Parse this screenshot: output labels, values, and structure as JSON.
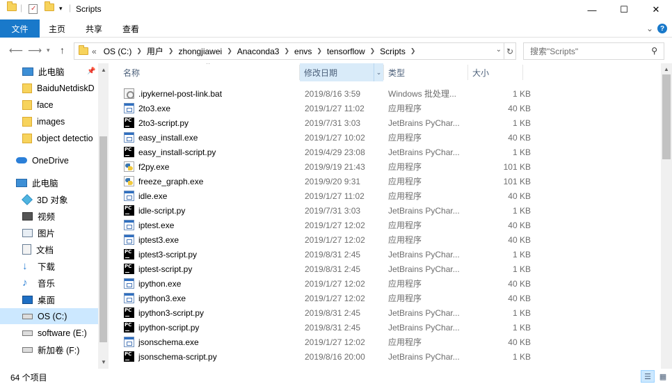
{
  "window": {
    "title": "Scripts",
    "minimize": "—",
    "maximize": "☐",
    "close": "✕"
  },
  "ribbon": {
    "file": "文件",
    "home": "主页",
    "share": "共享",
    "view": "查看",
    "expand": "⌄",
    "help": "?"
  },
  "address": {
    "overflow": "«",
    "crumbs": [
      "OS (C:)",
      "用户",
      "zhongjiawei",
      "Anaconda3",
      "envs",
      "tensorflow",
      "Scripts"
    ],
    "search_placeholder": "搜索\"Scripts\""
  },
  "nav": {
    "items": [
      {
        "label": "此电脑",
        "icon": "computer-icon"
      },
      {
        "label": "BaiduNetdiskD",
        "icon": "folder-icon"
      },
      {
        "label": "face",
        "icon": "folder-icon"
      },
      {
        "label": "images",
        "icon": "folder-icon"
      },
      {
        "label": "object detectio",
        "icon": "folder-icon"
      },
      {
        "label": "OneDrive",
        "icon": "onedrive-icon"
      },
      {
        "label": "此电脑",
        "icon": "computer-icon"
      },
      {
        "label": "3D 对象",
        "icon": "3d-objects-icon"
      },
      {
        "label": "视频",
        "icon": "video-icon"
      },
      {
        "label": "图片",
        "icon": "pictures-icon"
      },
      {
        "label": "文档",
        "icon": "documents-icon"
      },
      {
        "label": "下载",
        "icon": "download-icon"
      },
      {
        "label": "音乐",
        "icon": "music-icon"
      },
      {
        "label": "桌面",
        "icon": "desktop-icon"
      },
      {
        "label": "OS (C:)",
        "icon": "drive-icon"
      },
      {
        "label": "software (E:)",
        "icon": "drive-icon"
      },
      {
        "label": "新加卷 (F:)",
        "icon": "drive-icon"
      }
    ]
  },
  "columns": {
    "name": "名称",
    "date": "修改日期",
    "type": "类型",
    "size": "大小"
  },
  "files": [
    {
      "name": ".ipykernel-post-link.bat",
      "date": "2019/8/16 3:59",
      "type": "Windows 批处理...",
      "size": "1 KB",
      "icon": "bat"
    },
    {
      "name": "2to3.exe",
      "date": "2019/1/27 11:02",
      "type": "应用程序",
      "size": "40 KB",
      "icon": "exe"
    },
    {
      "name": "2to3-script.py",
      "date": "2019/7/31 3:03",
      "type": "JetBrains PyChar...",
      "size": "1 KB",
      "icon": "pc"
    },
    {
      "name": "easy_install.exe",
      "date": "2019/1/27 10:02",
      "type": "应用程序",
      "size": "40 KB",
      "icon": "exe"
    },
    {
      "name": "easy_install-script.py",
      "date": "2019/4/29 23:08",
      "type": "JetBrains PyChar...",
      "size": "1 KB",
      "icon": "pc"
    },
    {
      "name": "f2py.exe",
      "date": "2019/9/19 21:43",
      "type": "应用程序",
      "size": "101 KB",
      "icon": "py"
    },
    {
      "name": "freeze_graph.exe",
      "date": "2019/9/20 9:31",
      "type": "应用程序",
      "size": "101 KB",
      "icon": "py"
    },
    {
      "name": "idle.exe",
      "date": "2019/1/27 11:02",
      "type": "应用程序",
      "size": "40 KB",
      "icon": "exe"
    },
    {
      "name": "idle-script.py",
      "date": "2019/7/31 3:03",
      "type": "JetBrains PyChar...",
      "size": "1 KB",
      "icon": "pc"
    },
    {
      "name": "iptest.exe",
      "date": "2019/1/27 12:02",
      "type": "应用程序",
      "size": "40 KB",
      "icon": "exe"
    },
    {
      "name": "iptest3.exe",
      "date": "2019/1/27 12:02",
      "type": "应用程序",
      "size": "40 KB",
      "icon": "exe"
    },
    {
      "name": "iptest3-script.py",
      "date": "2019/8/31 2:45",
      "type": "JetBrains PyChar...",
      "size": "1 KB",
      "icon": "pc"
    },
    {
      "name": "iptest-script.py",
      "date": "2019/8/31 2:45",
      "type": "JetBrains PyChar...",
      "size": "1 KB",
      "icon": "pc"
    },
    {
      "name": "ipython.exe",
      "date": "2019/1/27 12:02",
      "type": "应用程序",
      "size": "40 KB",
      "icon": "exe"
    },
    {
      "name": "ipython3.exe",
      "date": "2019/1/27 12:02",
      "type": "应用程序",
      "size": "40 KB",
      "icon": "exe"
    },
    {
      "name": "ipython3-script.py",
      "date": "2019/8/31 2:45",
      "type": "JetBrains PyChar...",
      "size": "1 KB",
      "icon": "pc"
    },
    {
      "name": "ipython-script.py",
      "date": "2019/8/31 2:45",
      "type": "JetBrains PyChar...",
      "size": "1 KB",
      "icon": "pc"
    },
    {
      "name": "jsonschema.exe",
      "date": "2019/1/27 12:02",
      "type": "应用程序",
      "size": "40 KB",
      "icon": "exe"
    },
    {
      "name": "jsonschema-script.py",
      "date": "2019/8/16 20:00",
      "type": "JetBrains PyChar...",
      "size": "1 KB",
      "icon": "pc"
    }
  ],
  "status": {
    "count": "64 个项目"
  },
  "colors": {
    "accent": "#1979ca",
    "selection": "#cce8ff",
    "header_text": "#4c607a"
  }
}
